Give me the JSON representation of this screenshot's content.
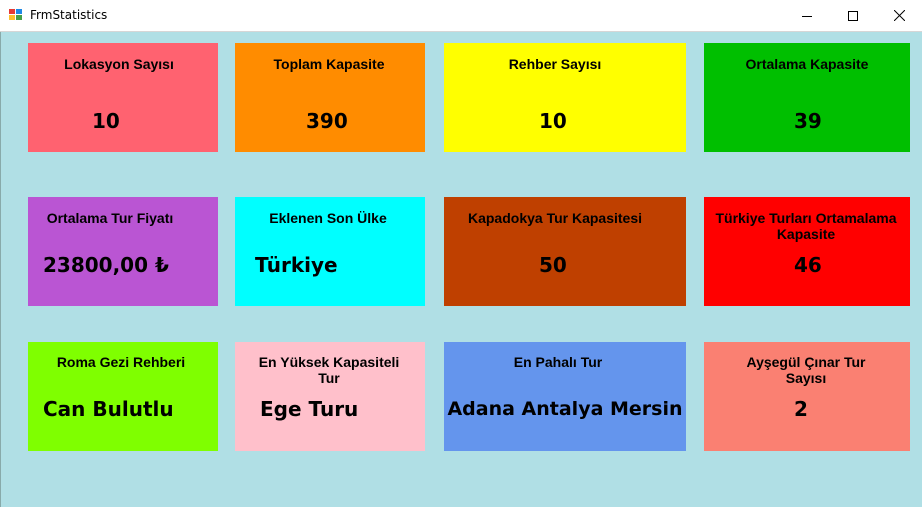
{
  "window": {
    "title": "FrmStatistics"
  },
  "cards": [
    {
      "label": "Lokasyon Sayısı",
      "value": "10",
      "color": "#ff6270"
    },
    {
      "label": "Toplam Kapasite",
      "value": "390",
      "color": "#ff8c00"
    },
    {
      "label": "Rehber Sayısı",
      "value": "10",
      "color": "#ffff00"
    },
    {
      "label": "Ortalama Kapasite",
      "value": "39",
      "color": "#00bf00"
    },
    {
      "label": "Ortalama Tur Fiyatı",
      "value": "23800,00 ₺",
      "color": "#ba55d3"
    },
    {
      "label": "Eklenen Son Ülke",
      "value": "Türkiye",
      "color": "#00ffff"
    },
    {
      "label": "Kapadokya Tur Kapasitesi",
      "value": "50",
      "color": "#bf4000"
    },
    {
      "label": "Türkiye Turları Ortamalama Kapasite",
      "value": "46",
      "color": "#ff0000"
    },
    {
      "label": "Roma Gezi Rehberi",
      "value": "Can Bulutlu",
      "color": "#7fff00"
    },
    {
      "label": "En Yüksek Kapasiteli Tur",
      "value": "Ege Turu",
      "color": "#ffc0cb"
    },
    {
      "label": "En Pahalı Tur",
      "value": "Adana Antalya Mersin",
      "color": "#6495ed"
    },
    {
      "label": "Ayşegül Çınar Tur Sayısı",
      "value": "2",
      "color": "#fa8072"
    }
  ]
}
